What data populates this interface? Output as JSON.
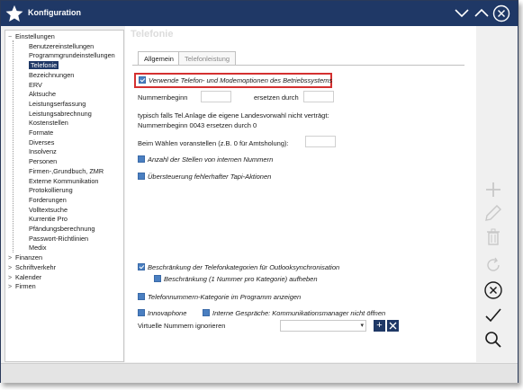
{
  "window": {
    "title": "Konfiguration"
  },
  "tree": {
    "items": [
      {
        "label": "Einstellungen",
        "level": 0,
        "expander": "−"
      },
      {
        "label": "Benutzereinstellungen",
        "level": 1
      },
      {
        "label": "Programmgrundeinstellungen",
        "level": 1
      },
      {
        "label": "Telefonie",
        "level": 1,
        "selected": true
      },
      {
        "label": "Bezeichnungen",
        "level": 1
      },
      {
        "label": "ERV",
        "level": 1
      },
      {
        "label": "Aktsuche",
        "level": 1
      },
      {
        "label": "Leistungserfassung",
        "level": 1
      },
      {
        "label": "Leistungsabrechnung",
        "level": 1
      },
      {
        "label": "Kostenstellen",
        "level": 1
      },
      {
        "label": "Formate",
        "level": 1
      },
      {
        "label": "Diverses",
        "level": 1
      },
      {
        "label": "Insolvenz",
        "level": 1
      },
      {
        "label": "Personen",
        "level": 1
      },
      {
        "label": "Firmen-,Grundbuch, ZMR",
        "level": 1
      },
      {
        "label": "Externe Kommunikation",
        "level": 1
      },
      {
        "label": "Protokollierung",
        "level": 1
      },
      {
        "label": "Forderungen",
        "level": 1
      },
      {
        "label": "Volltextsuche",
        "level": 1
      },
      {
        "label": "Kurrentie Pro",
        "level": 1
      },
      {
        "label": "Pfändungsberechnung",
        "level": 1
      },
      {
        "label": "Passwort-Richtlinien",
        "level": 1
      },
      {
        "label": "Medix",
        "level": 1
      },
      {
        "label": "Finanzen",
        "level": 0,
        "expander": ">"
      },
      {
        "label": "Schriftverkehr",
        "level": 0,
        "expander": ">"
      },
      {
        "label": "Kalender",
        "level": 0,
        "expander": ">"
      },
      {
        "label": "Firmen",
        "level": 0,
        "expander": ">"
      }
    ]
  },
  "main": {
    "section_title": "Telefonie",
    "tabs": [
      {
        "label": "Allgemein",
        "active": true
      },
      {
        "label": "Telefonleistung",
        "active": false
      }
    ],
    "use_modem_label": "Verwende Telefon- und Modemoptionen des Betriebssystems",
    "nummernbeginn_label": "Nummernbeginn",
    "ersetzen_label": "ersetzen durch",
    "hint_line1": "typisch falls Tel.Anlage die eigene Landesvorwahl nicht verträgt:",
    "hint_line2": "Nummernbeginn 0043 ersetzen durch 0",
    "prefix_label": "Beim Wählen voranstellen (z.B. 0 für Amtsholung):",
    "internal_digits_label": "Anzahl der Stellen von internen Nummern",
    "tapi_label": "Übersteuerung fehlerhafter Tapi-Aktionen",
    "outlook_restrict_label": "Beschränkung der Telefonkategorien für Outlooksynchronisation",
    "outlook_restrict_sub_label": "Beschränkung (1 Nummer pro Kategorie) aufheben",
    "show_category_label": "Telefonnummern-Kategorie im Programm anzeigen",
    "innovaphone_label": "Innovaphone",
    "internal_calls_label": "Interne Gespräche: Kommunikationsmanager nicht öffnen",
    "virtual_numbers_label": "Virtuelle Nummern ignorieren",
    "virtual_numbers_value": ""
  },
  "actions": {
    "add": "plus-icon",
    "edit": "pencil-icon",
    "delete": "trash-icon",
    "refresh": "refresh-icon",
    "cancel": "cancel-icon",
    "confirm": "check-icon",
    "search": "search-icon"
  },
  "colors": {
    "titlebar": "#1f3866",
    "accent": "#4a7fc1",
    "highlight": "#d43030"
  }
}
